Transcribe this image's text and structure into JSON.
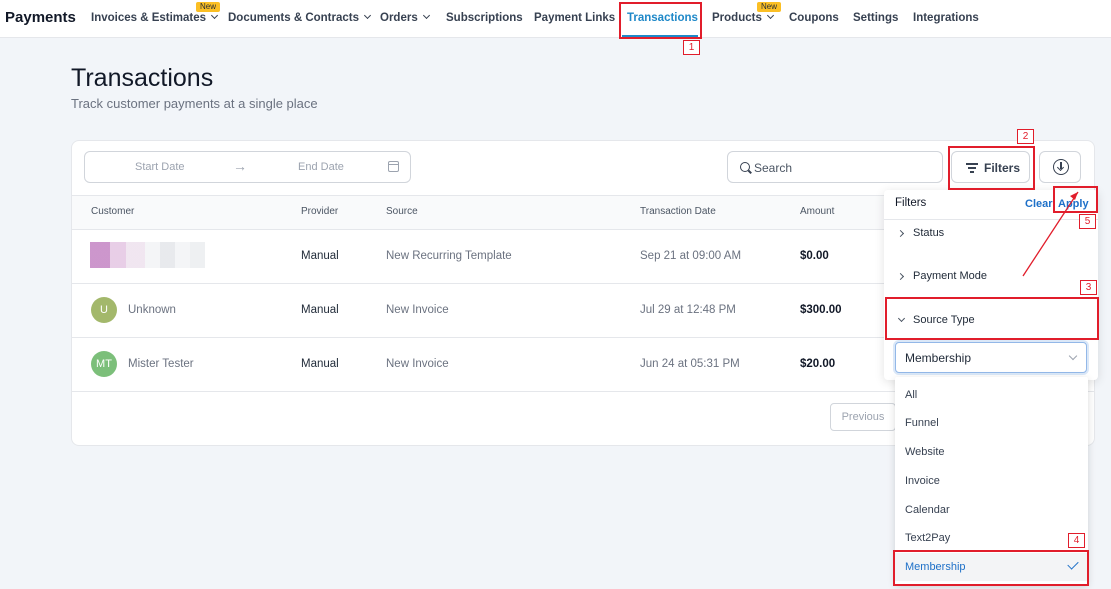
{
  "brand": "Payments",
  "nav": {
    "items": [
      {
        "label": "Invoices & Estimates",
        "badge": "New"
      },
      {
        "label": "Documents & Contracts"
      },
      {
        "label": "Orders"
      },
      {
        "label": "Subscriptions"
      },
      {
        "label": "Payment Links"
      },
      {
        "label": "Transactions"
      },
      {
        "label": "Products",
        "badge": "New"
      },
      {
        "label": "Coupons"
      },
      {
        "label": "Settings"
      },
      {
        "label": "Integrations"
      }
    ]
  },
  "page": {
    "title": "Transactions",
    "subtitle": "Track customer payments at a single place"
  },
  "toolbar": {
    "start_date": "Start Date",
    "end_date": "End Date",
    "search_placeholder": "Search",
    "filters_label": "Filters"
  },
  "table": {
    "headers": [
      "Customer",
      "Provider",
      "Source",
      "Transaction Date",
      "Amount"
    ],
    "rows": [
      {
        "customer": "",
        "initials": "",
        "provider": "Manual",
        "source": "New Recurring Template",
        "date": "Sep 21 at 09:00 AM",
        "amount": "$0.00"
      },
      {
        "customer": "Unknown",
        "initials": "U",
        "avatar_color": "#a3b86b",
        "provider": "Manual",
        "source": "New Invoice",
        "date": "Jul 29 at 12:48 PM",
        "amount": "$300.00"
      },
      {
        "customer": "Mister Tester",
        "initials": "MT",
        "avatar_color": "#7cbf7a",
        "provider": "Manual",
        "source": "New Invoice",
        "date": "Jun 24 at 05:31 PM",
        "amount": "$20.00"
      }
    ]
  },
  "pagination": {
    "previous": "Previous"
  },
  "filter_panel": {
    "title": "Filters",
    "clear": "Clear",
    "apply": "Apply",
    "sections": [
      "Status",
      "Payment Mode",
      "Source Type"
    ],
    "source_type_selected": "Membership",
    "options": [
      "All",
      "Funnel",
      "Website",
      "Invoice",
      "Calendar",
      "Text2Pay",
      "Membership"
    ]
  },
  "annotations": [
    "1",
    "2",
    "3",
    "4",
    "5"
  ],
  "colors": {
    "accent": "#1e88c8",
    "link": "#1e70c8",
    "annotation": "#e11d2b"
  }
}
